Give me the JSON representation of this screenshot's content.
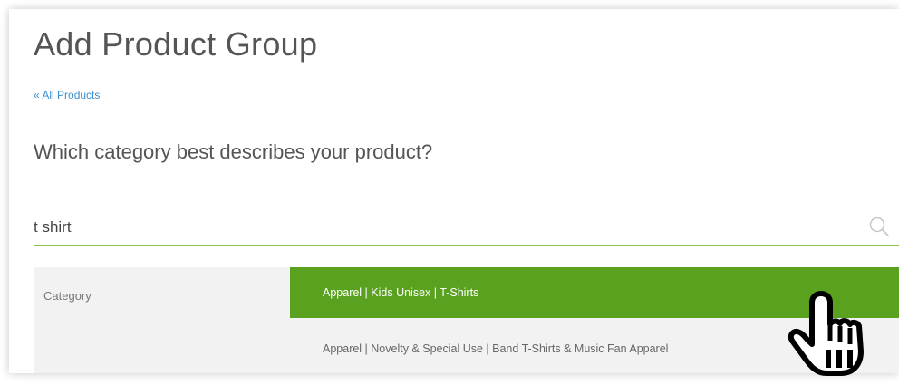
{
  "header": {
    "title": "Add Product Group",
    "back_link": "« All Products"
  },
  "question": {
    "text": "Which category best describes your product?"
  },
  "search": {
    "value": "t shirt",
    "icon": "search-icon"
  },
  "results": {
    "category_label": "Category",
    "options": [
      {
        "label": "Apparel | Kids Unisex | T-Shirts",
        "selected": true
      },
      {
        "label": "Apparel | Novelty & Special Use | Band T-Shirts & Music Fan Apparel",
        "selected": false
      }
    ]
  },
  "colors": {
    "accent_green": "#5aa120",
    "underline_green": "#8bc34a",
    "link_blue": "#3a8fd0",
    "text_gray": "#555555"
  },
  "cursor": {
    "icon": "hand-pointer-cursor-icon"
  }
}
